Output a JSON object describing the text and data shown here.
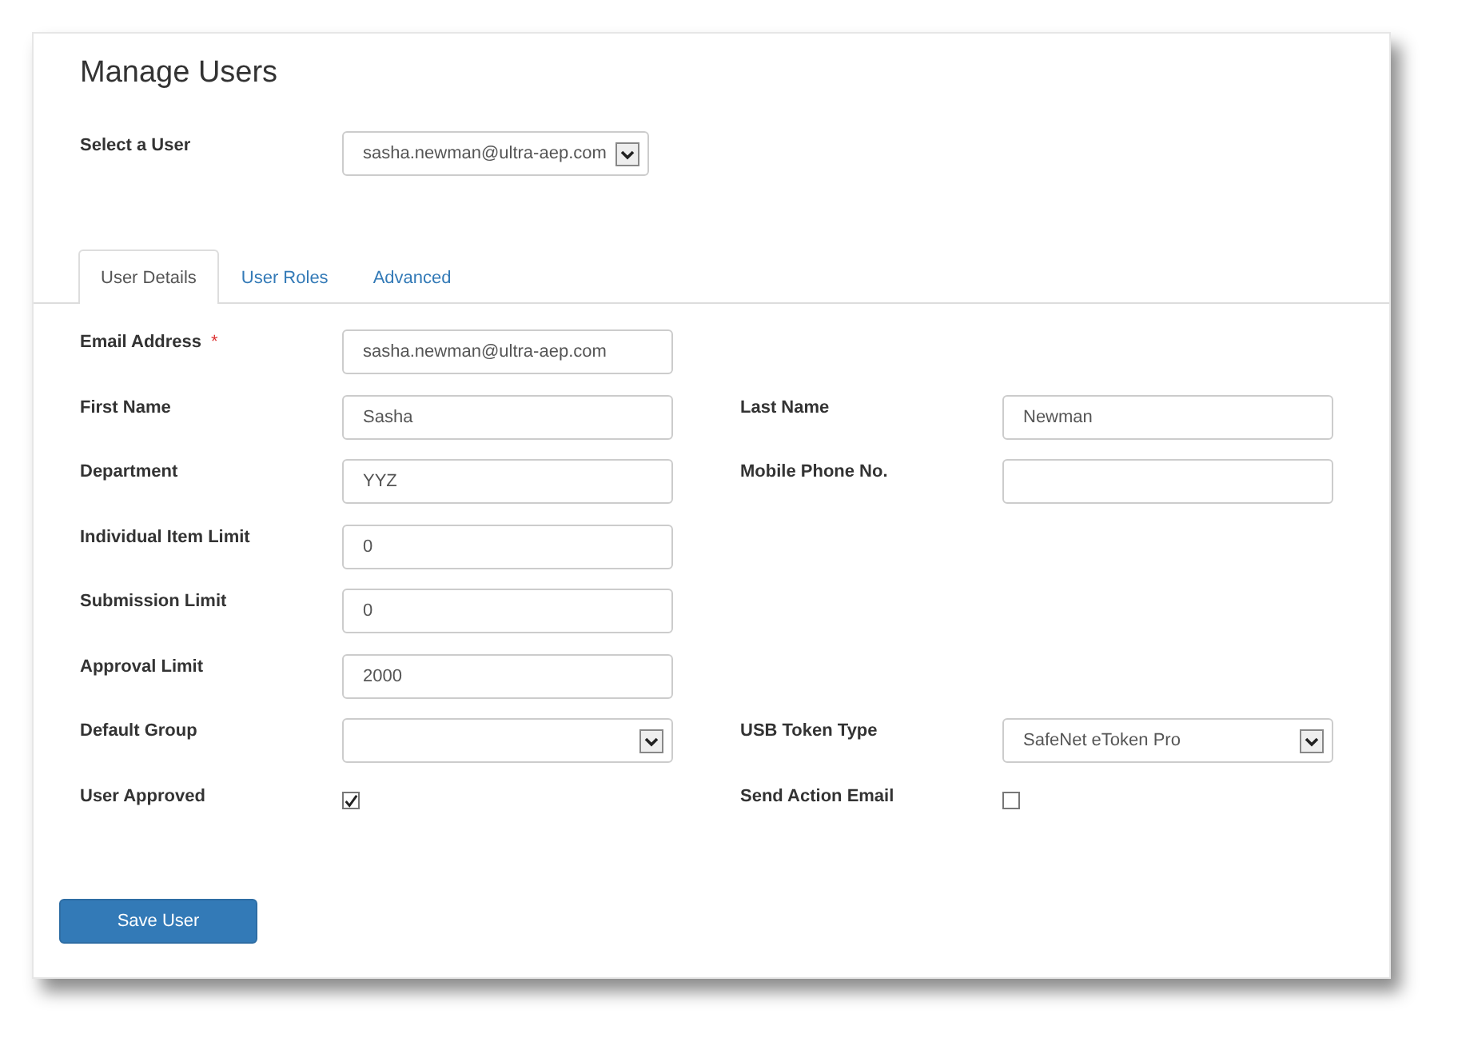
{
  "title": "Manage Users",
  "user_select": {
    "label": "Select a User",
    "value": "sasha.newman@ultra-aep.com"
  },
  "tabs": [
    {
      "label": "User Details",
      "selected": true
    },
    {
      "label": "User Roles",
      "selected": false
    },
    {
      "label": "Advanced",
      "selected": false
    }
  ],
  "rows": [
    {
      "left": {
        "label": "Email Address",
        "required_mark": "*",
        "kind": "text",
        "value": "sasha.newman@ultra-aep.com"
      }
    },
    {
      "left": {
        "label": "First Name",
        "kind": "text",
        "value": "Sasha"
      },
      "right": {
        "label": "Last Name",
        "kind": "text",
        "value": "Newman"
      }
    },
    {
      "left": {
        "label": "Department",
        "kind": "text",
        "value": "YYZ"
      },
      "right": {
        "label": "Mobile Phone No.",
        "kind": "text"
      }
    },
    {
      "left": {
        "label": "Individual Item Limit",
        "kind": "text",
        "value": "0"
      }
    },
    {
      "left": {
        "label": "Submission Limit",
        "kind": "text",
        "value": "0"
      }
    },
    {
      "left": {
        "label": "Approval Limit",
        "kind": "text",
        "value": "2000"
      }
    },
    {
      "left": {
        "label": "Default Group",
        "kind": "select"
      },
      "right": {
        "label": "USB Token Type",
        "kind": "select",
        "value": "SafeNet eToken Pro"
      }
    },
    {
      "left": {
        "label": "User Approved",
        "kind": "checkbox",
        "checked": true
      },
      "right": {
        "label": "Send Action Email",
        "kind": "checkbox",
        "checked": false
      }
    }
  ],
  "save_button": "Save User"
}
